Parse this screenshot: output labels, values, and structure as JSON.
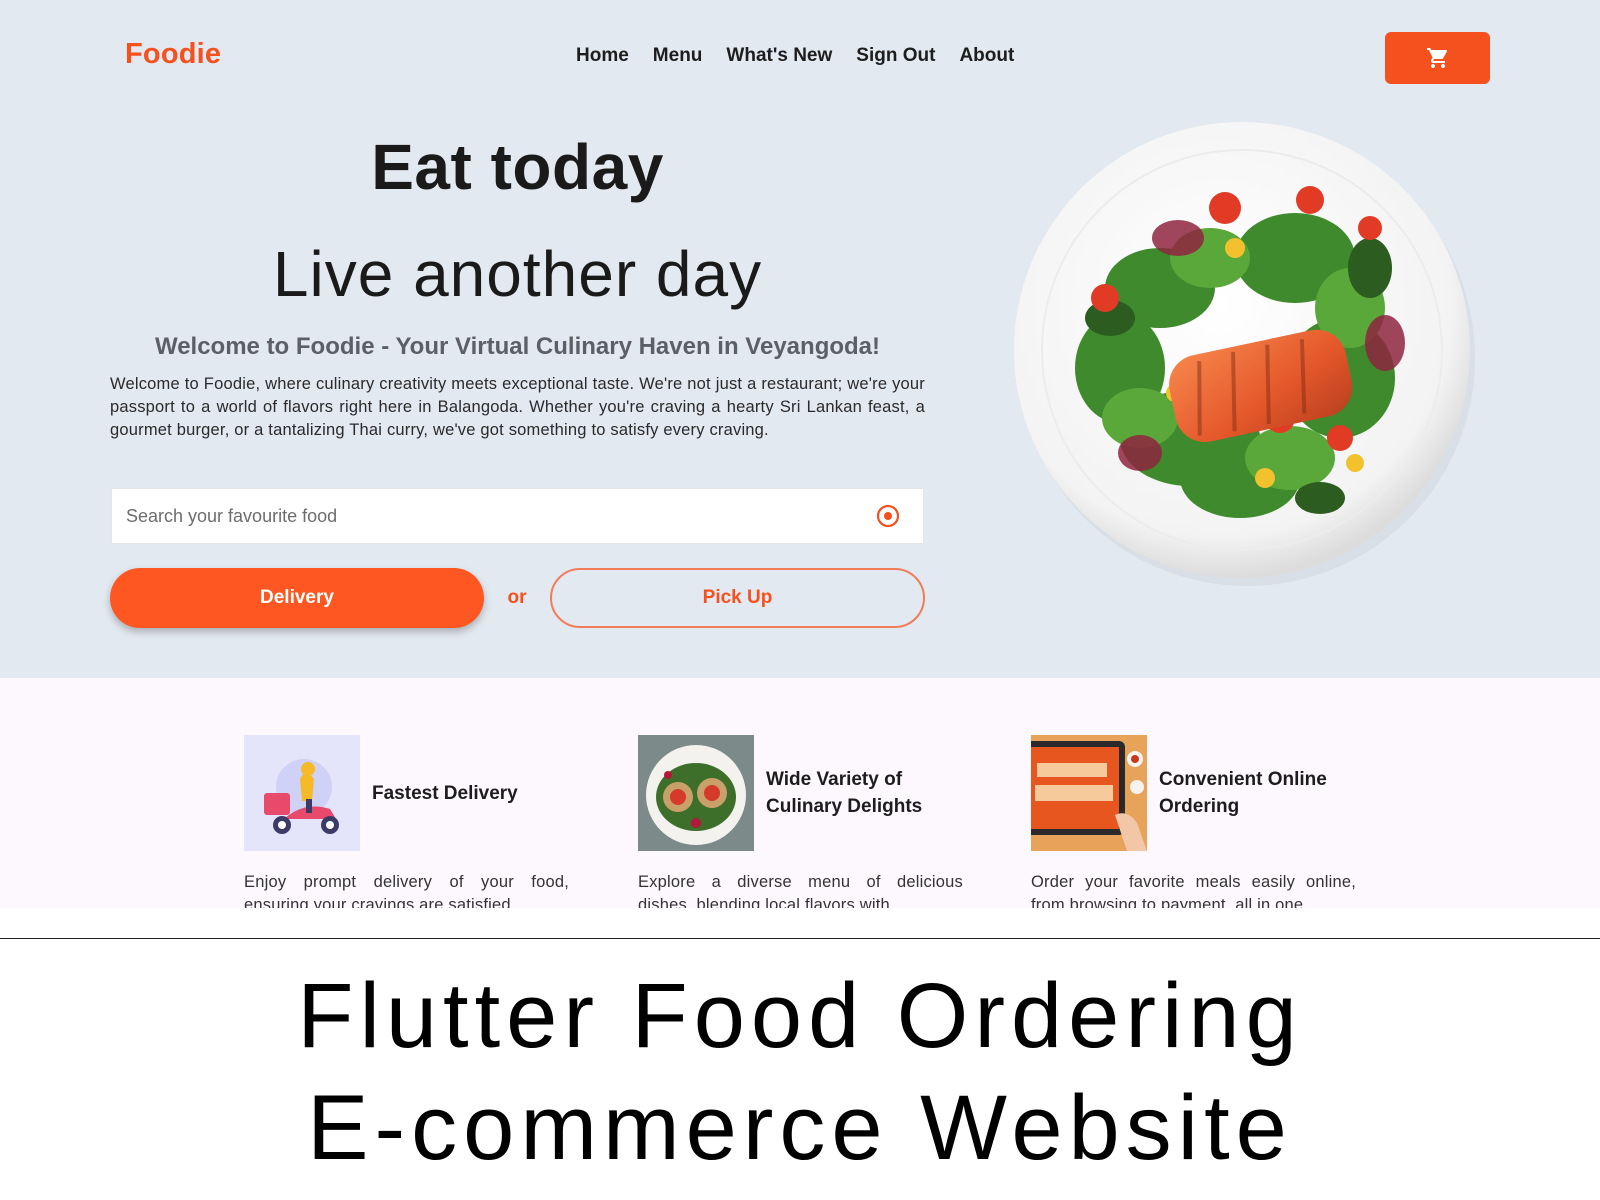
{
  "header": {
    "logo": "Foodie",
    "nav": [
      "Home",
      "Menu",
      "What's New",
      "Sign Out",
      "About"
    ],
    "cart_icon": "cart-icon"
  },
  "hero": {
    "headline": "Eat today",
    "subline": "Live another day",
    "welcome_title": "Welcome to Foodie - Your Virtual Culinary Haven in Veyangoda!",
    "welcome_text": "Welcome to Foodie, where culinary creativity meets exceptional taste. We're not just a restaurant; we're your passport to a world of flavors right here in Balangoda. Whether you're craving a hearty Sri Lankan feast, a gourmet burger, or a tantalizing Thai curry, we've got something to satisfy every craving.",
    "search_placeholder": "Search your favourite food",
    "search_icon": "target-icon",
    "delivery_label": "Delivery",
    "or_label": "or",
    "pickup_label": "Pick Up",
    "image": "salmon-salad-plate"
  },
  "features": [
    {
      "title": "Fastest Delivery",
      "text": "Enjoy prompt delivery of your food, ensuring your cravings are satisfied",
      "image": "delivery-scooter-illustration"
    },
    {
      "title": "Wide Variety of Culinary Delights",
      "text": "Explore a diverse menu of delicious dishes, blending local flavors with",
      "image": "food-dish-photo"
    },
    {
      "title": "Convenient Online Ordering",
      "text": "Order your favorite meals easily online, from browsing to payment, all in one",
      "image": "order-online-tablet"
    }
  ],
  "caption": {
    "line1": "Flutter Food Ordering",
    "line2": "E-commerce Website"
  },
  "colors": {
    "accent": "#f4511e",
    "hero_bg": "#e3e9f0",
    "features_bg": "#fdf8fd"
  }
}
